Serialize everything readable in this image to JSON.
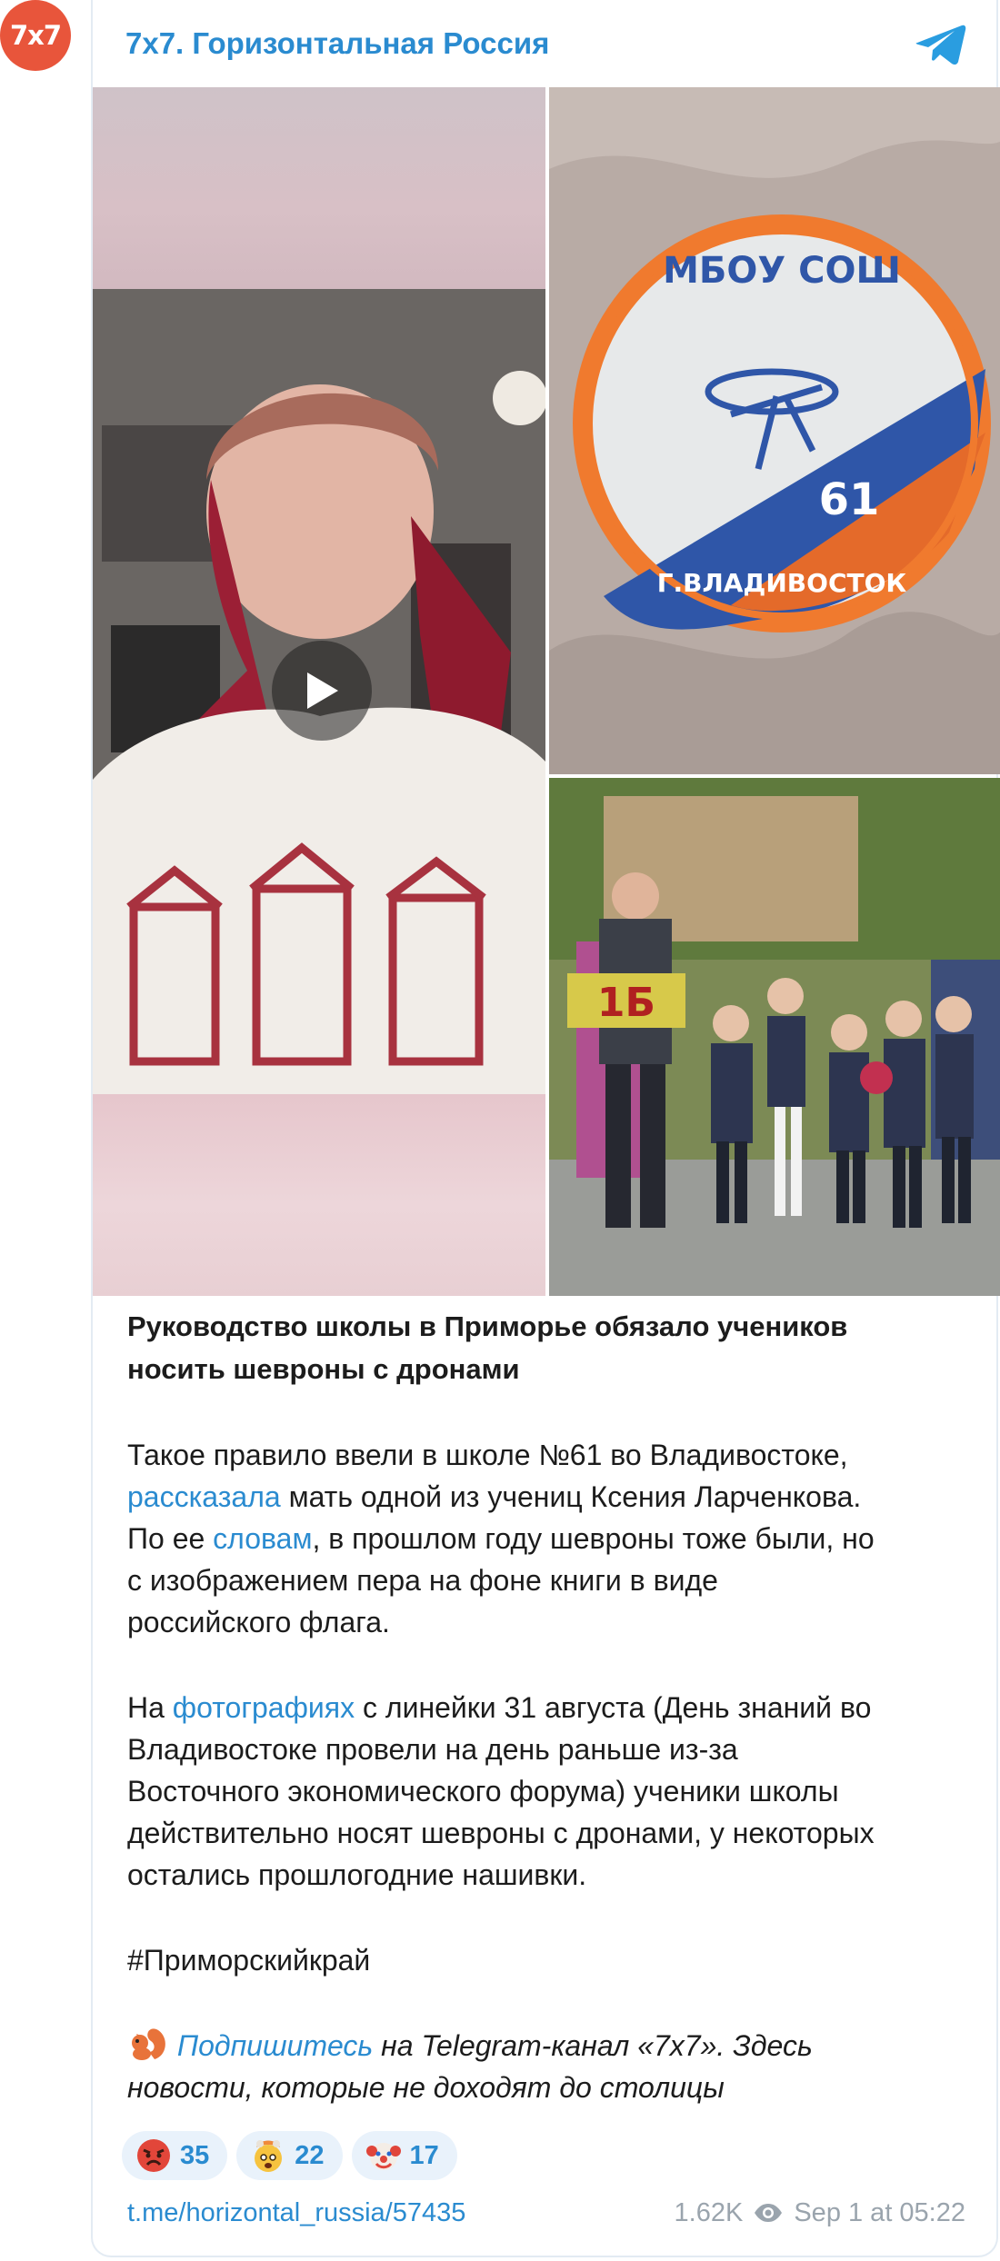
{
  "channel": {
    "avatar_text": "7x7",
    "name": "7x7. Горизонтальная Россия",
    "avatar_color": "#e8553b",
    "accent_color": "#2a8bd0"
  },
  "media": {
    "video_icon": "play-icon",
    "patch_text_top": "МБОУ СОШ",
    "patch_number": "61",
    "patch_text_bottom": "Г.ВЛАДИВОСТОК",
    "class_sign": "1Б"
  },
  "post": {
    "title_line1": "Руководство школы в Приморье обязало учеников",
    "title_line2": "носить шевроны с дронами",
    "p1": {
      "l1": "Такое правило ввели в школе №61 во Владивостоке,",
      "l2_link": "рассказала",
      "l2_rest": " мать одной из учениц Ксения Ларченкова.",
      "l3_pre": "По ее ",
      "l3_link": "словам",
      "l3_rest": ", в прошлом году шевроны тоже были, но",
      "l4": "с изображением пера на фоне книги в виде",
      "l5": "российского флага."
    },
    "p2": {
      "l1_pre": "На ",
      "l1_link": "фотографиях",
      "l1_rest": " с линейки 31 августа (День знаний во",
      "l2": "Владивостоке провели на день раньше из-за",
      "l3": "Восточного экономического форума) ученики школы",
      "l4": "действительно носят шевроны с дронами, у некоторых",
      "l5": "остались прошлогодние нашивки."
    },
    "hashtag": "#Приморскийкрай",
    "promo": {
      "icon": "squirrel-icon",
      "link": "Подпишитесь",
      "l1_rest": " на Telegram-канал «7x7». Здесь",
      "l2": "новости, которые не доходят до столицы"
    }
  },
  "reactions": [
    {
      "icon": "angry-face-icon",
      "count": "35"
    },
    {
      "icon": "exploding-head-icon",
      "count": "22"
    },
    {
      "icon": "clown-face-icon",
      "count": "17"
    }
  ],
  "footer": {
    "link": "t.me/horizontal_russia/57435",
    "views": "1.62K",
    "date": "Sep 1 at 05:22"
  }
}
